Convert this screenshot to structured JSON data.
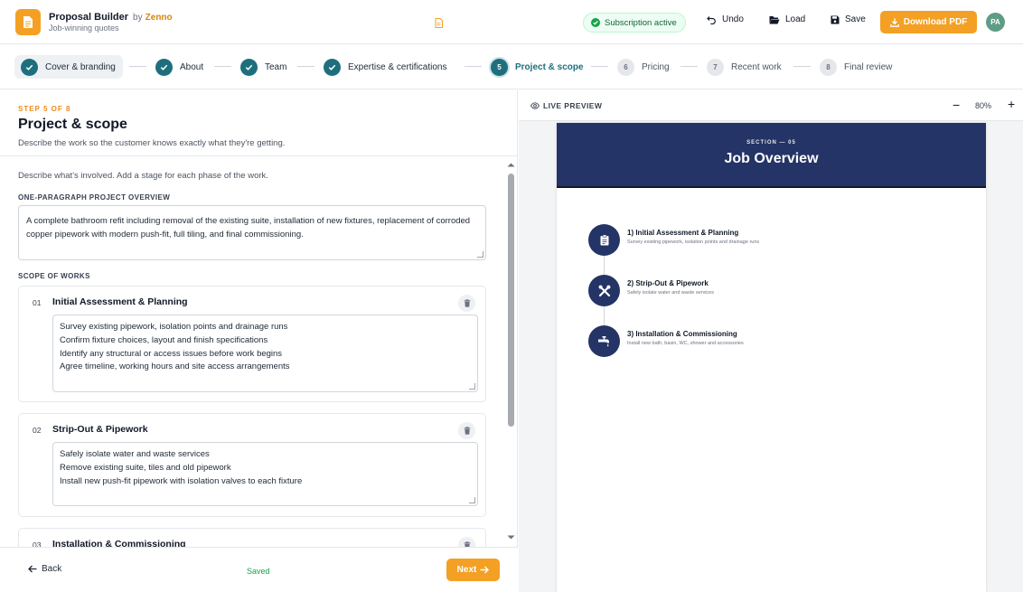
{
  "header": {
    "brand_title": "Proposal Builder",
    "brand_by": "by",
    "brand_vendor": "Zenno",
    "brand_sub": "Job-winning quotes",
    "subscription": "Subscription active",
    "undo": "Undo",
    "load": "Load",
    "save": "Save",
    "download": "Download PDF",
    "avatar": "PA"
  },
  "stepper": [
    {
      "num": "1",
      "label": "Cover & branding",
      "state": "done"
    },
    {
      "num": "2",
      "label": "About",
      "state": "done"
    },
    {
      "num": "3",
      "label": "Team",
      "state": "done"
    },
    {
      "num": "4",
      "label": "Expertise & certifications",
      "state": "done"
    },
    {
      "num": "5",
      "label": "Project & scope",
      "state": "active"
    },
    {
      "num": "6",
      "label": "Pricing",
      "state": "todo"
    },
    {
      "num": "7",
      "label": "Recent work",
      "state": "todo"
    },
    {
      "num": "8",
      "label": "Final review",
      "state": "todo"
    }
  ],
  "form": {
    "kicker": "STEP 5 OF 8",
    "title": "Project & scope",
    "desc": "Describe the work so the customer knows exactly what they're getting.",
    "intro": "Describe what's involved. Add a stage for each phase of the work.",
    "overview_label": "ONE-PARAGRAPH PROJECT OVERVIEW",
    "overview_text": "A complete bathroom refit including removal of the existing suite, installation of new fixtures, replacement of corroded copper pipework with modern push-fit, full tiling, and final commissioning.",
    "scope_label": "SCOPE OF WORKS",
    "stages": [
      {
        "num": "01",
        "title": "Initial Assessment & Planning",
        "lines": [
          "Survey existing pipework, isolation points and drainage runs",
          "Confirm fixture choices, layout and finish specifications",
          "Identify any structural or access issues before work begins",
          "Agree timeline, working hours and site access arrangements"
        ]
      },
      {
        "num": "02",
        "title": "Strip-Out & Pipework",
        "lines": [
          "Safely isolate water and waste services",
          "Remove existing suite, tiles and old pipework",
          "Install new push-fit pipework with isolation valves to each fixture"
        ]
      },
      {
        "num": "03",
        "title": "Installation & Commissioning",
        "lines": []
      }
    ]
  },
  "footer": {
    "back": "Back",
    "saved": "Saved",
    "next": "Next"
  },
  "preview": {
    "label": "LIVE PREVIEW",
    "zoom": "80%",
    "section_kicker": "SECTION — 05",
    "section_title": "Job Overview",
    "items": [
      {
        "title": "1) Initial Assessment & Planning",
        "sub": "Survey existing pipework, isolation points and drainage runs",
        "icon": "clipboard-icon"
      },
      {
        "title": "2) Strip-Out & Pipework",
        "sub": "Safely isolate water and waste services",
        "icon": "tools-icon"
      },
      {
        "title": "3) Installation & Commissioning",
        "sub": "Install new bath, basin, WC, shower and accessories",
        "icon": "faucet-icon"
      }
    ]
  },
  "colors": {
    "accent": "#f4a024",
    "teal": "#1e6f7d",
    "navy": "#253466",
    "saved_green": "#16a34a"
  }
}
